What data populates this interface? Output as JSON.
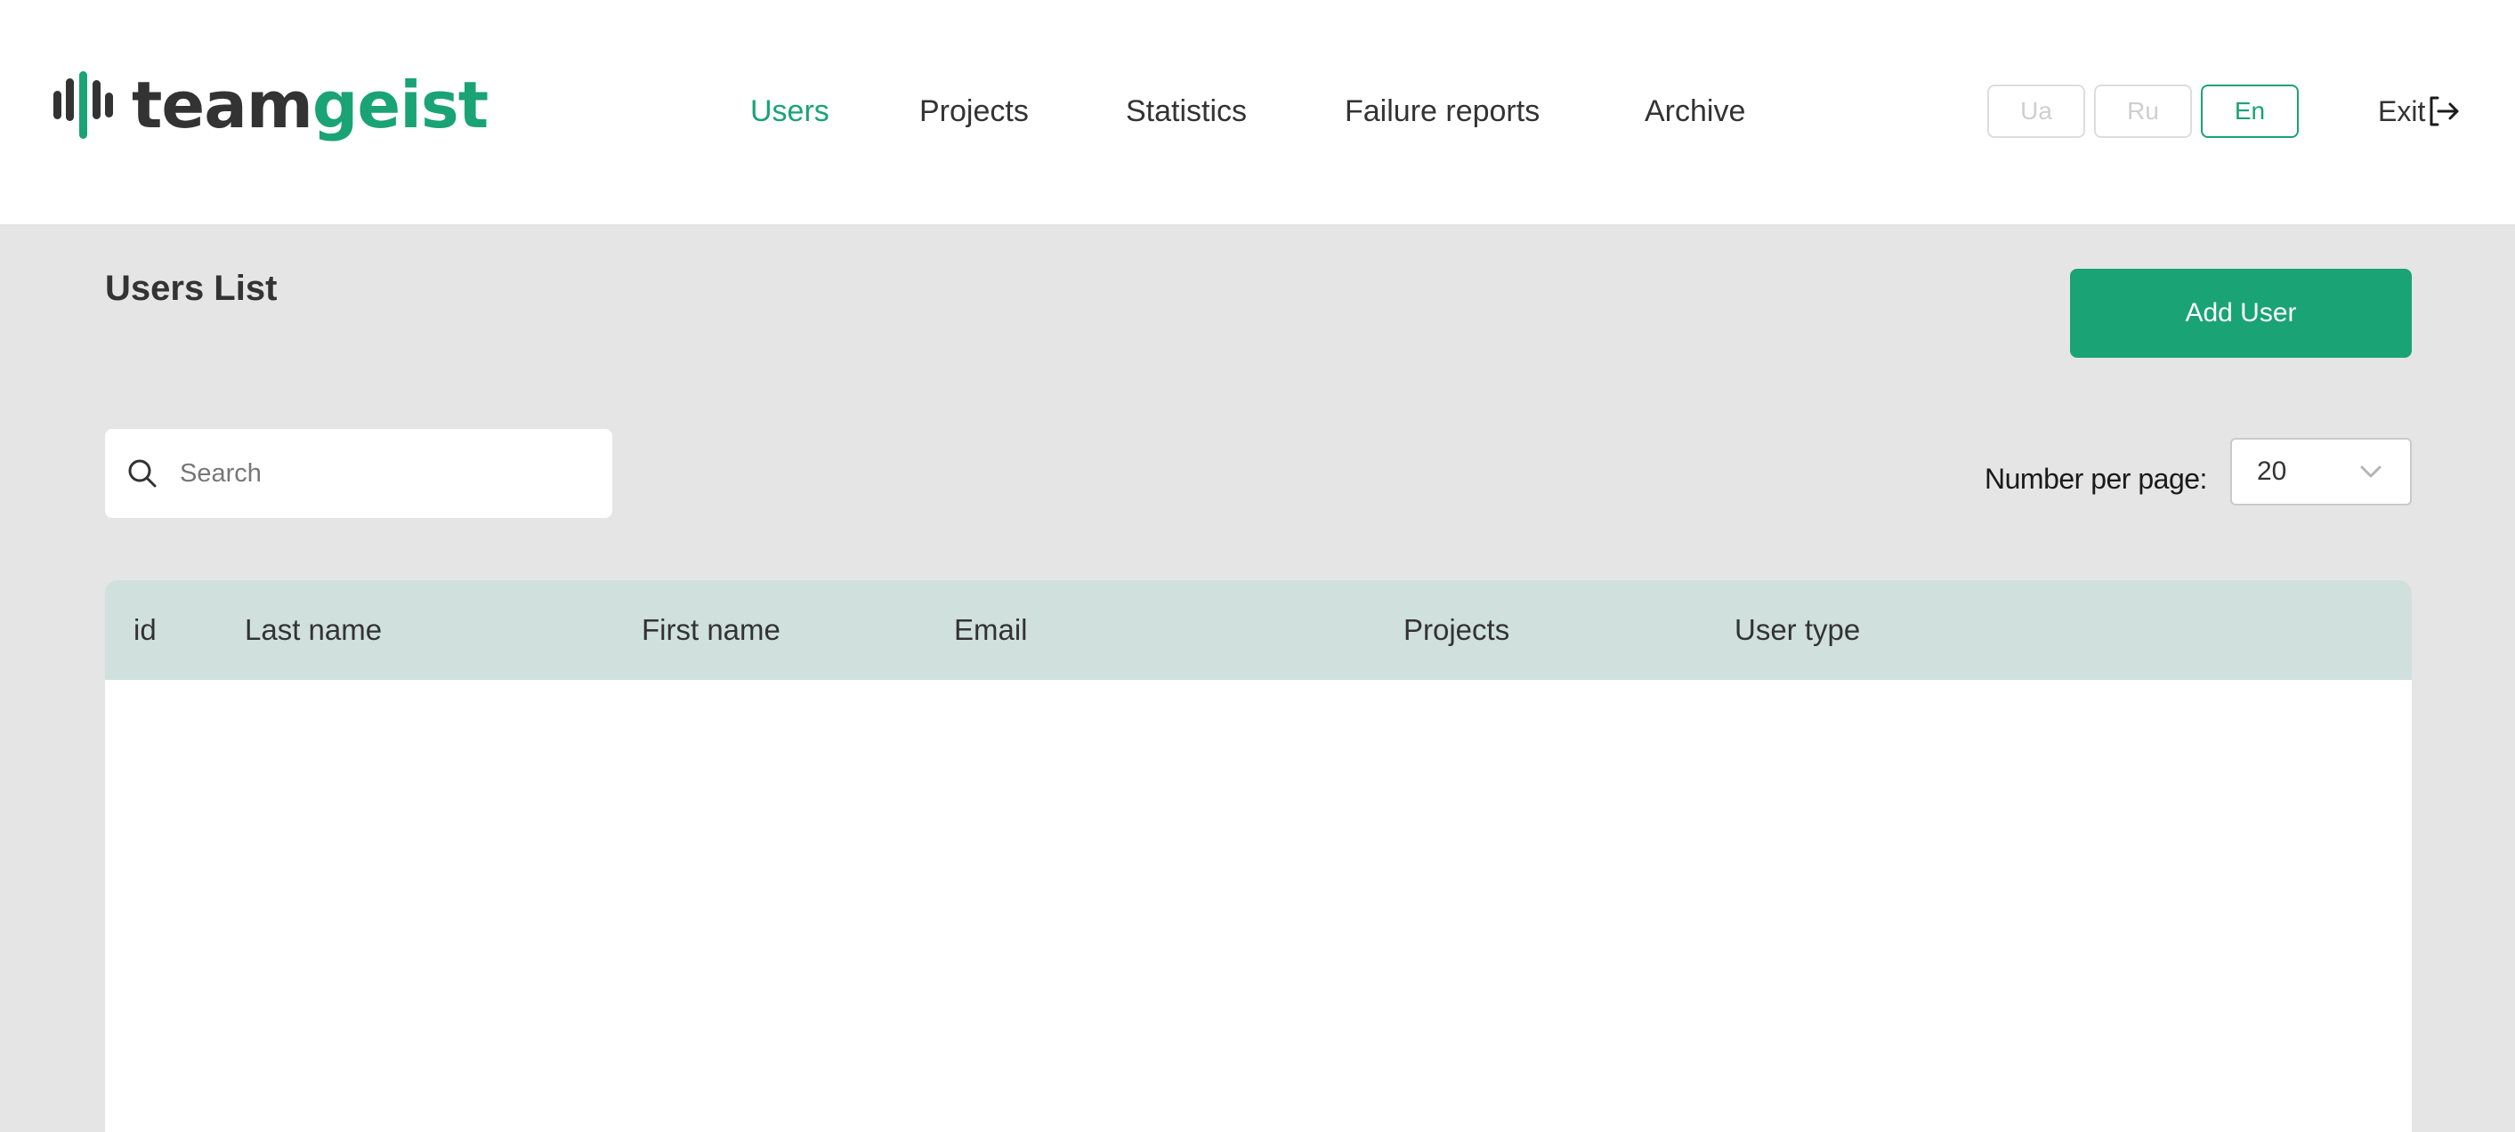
{
  "header": {
    "logo": {
      "part1": "team",
      "part2": "geist"
    },
    "nav": [
      {
        "label": "Users",
        "active": true
      },
      {
        "label": "Projects",
        "active": false
      },
      {
        "label": "Statistics",
        "active": false
      },
      {
        "label": "Failure reports",
        "active": false
      },
      {
        "label": "Archive",
        "active": false
      }
    ],
    "languages": [
      {
        "label": "Ua",
        "active": false
      },
      {
        "label": "Ru",
        "active": false
      },
      {
        "label": "En",
        "active": true
      }
    ],
    "exit_label": "Exit"
  },
  "main": {
    "title": "Users List",
    "add_user_label": "Add User",
    "search": {
      "placeholder": "Search",
      "value": ""
    },
    "per_page": {
      "label": "Number per page:",
      "value": "20"
    },
    "table": {
      "columns": [
        "id",
        "Last name",
        "First name",
        "Email",
        "Projects",
        "User type"
      ],
      "rows": []
    }
  },
  "colors": {
    "accent": "#1aa375",
    "text": "#333333",
    "background": "#e5e5e5",
    "table_header": "#d0e0dc"
  },
  "icons": {
    "logo": "sound-wave-icon",
    "exit": "logout-arrow-icon",
    "search": "search-icon",
    "select": "chevron-down-icon"
  }
}
